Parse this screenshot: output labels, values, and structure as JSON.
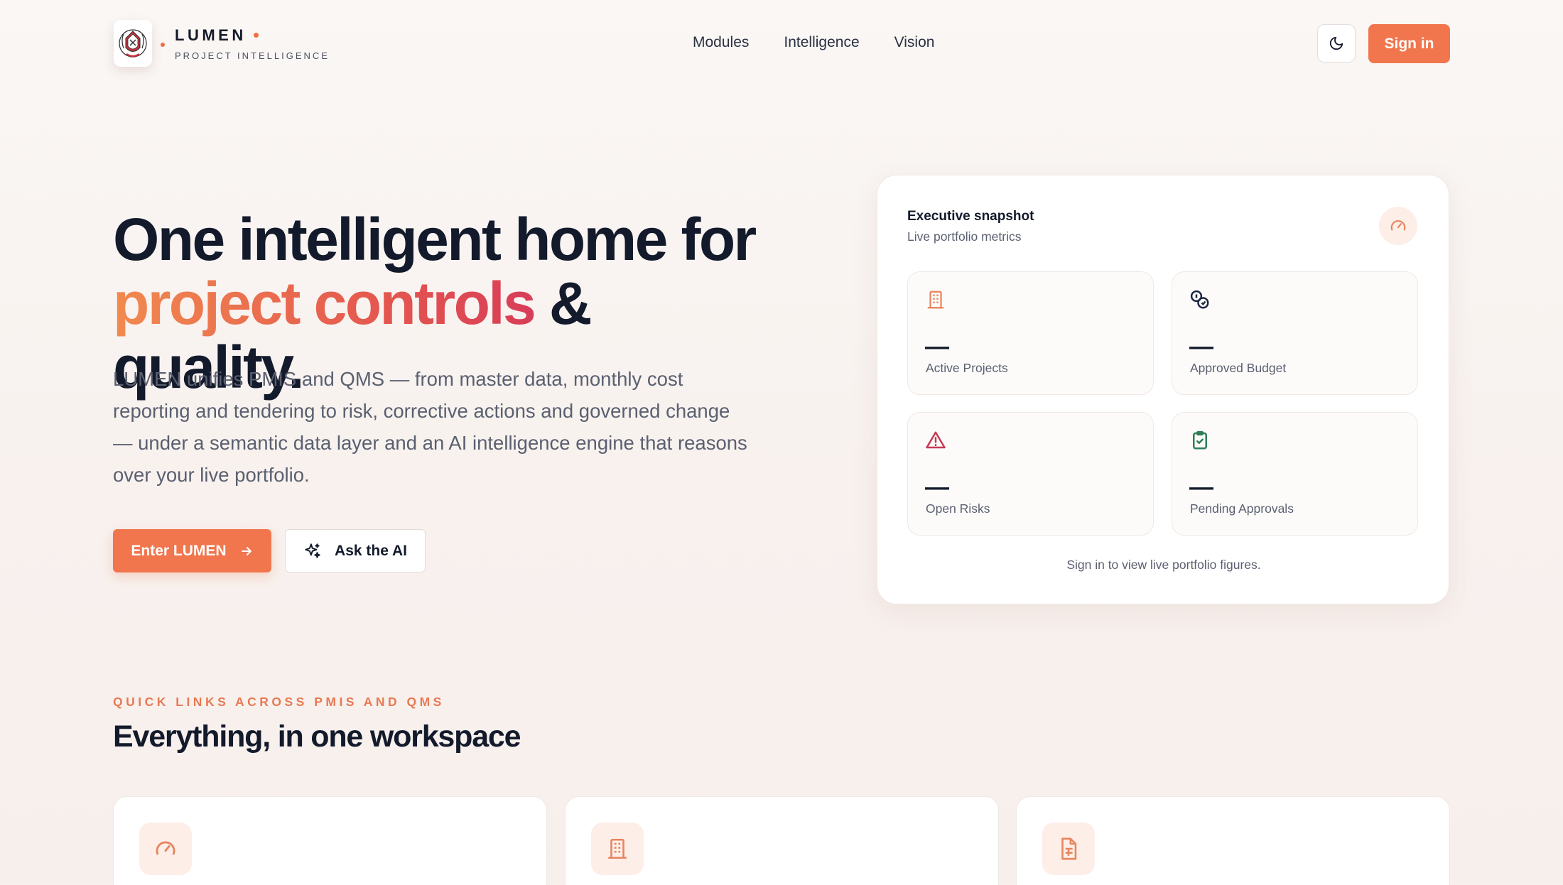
{
  "brand": {
    "name": "LUMEN",
    "tagline": "PROJECT INTELLIGENCE",
    "logo_icon": "crest-logo-icon",
    "accent_color": "#f1764d"
  },
  "nav": {
    "links": [
      "Modules",
      "Intelligence",
      "Vision"
    ],
    "theme_toggle_icon": "moon-icon",
    "signin_label": "Sign in"
  },
  "hero": {
    "title_line1": "One intelligent home for",
    "title_accent": "project controls",
    "title_rest": "& quality.",
    "description": "LUMEN unifies PMIS and QMS — from master data, monthly cost reporting and tendering to risk, corrective actions and governed change — under a semantic data layer and an AI intelligence engine that reasons over your live portfolio.",
    "primary_cta": "Enter LUMEN",
    "secondary_cta": "Ask the AI"
  },
  "snapshot": {
    "title": "Executive snapshot",
    "subtitle": "Live portfolio metrics",
    "header_icon": "gauge-icon",
    "metrics": [
      {
        "icon": "building-icon",
        "value": "—",
        "label": "Active Projects",
        "icon_color": "#e8855e"
      },
      {
        "icon": "coins-icon",
        "value": "—",
        "label": "Approved Budget",
        "icon_color": "#1c2740"
      },
      {
        "icon": "alert-triangle-icon",
        "value": "—",
        "label": "Open Risks",
        "icon_color": "#c43b52"
      },
      {
        "icon": "clipboard-check-icon",
        "value": "—",
        "label": "Pending Approvals",
        "icon_color": "#2f7d57"
      }
    ],
    "footer": "Sign in to view live portfolio figures."
  },
  "quick_links": {
    "kicker": "QUICK LINKS ACROSS PMIS AND QMS",
    "title": "Everything, in one workspace",
    "cards": [
      {
        "icon": "gauge-icon"
      },
      {
        "icon": "building-icon"
      },
      {
        "icon": "file-spreadsheet-icon"
      }
    ]
  }
}
